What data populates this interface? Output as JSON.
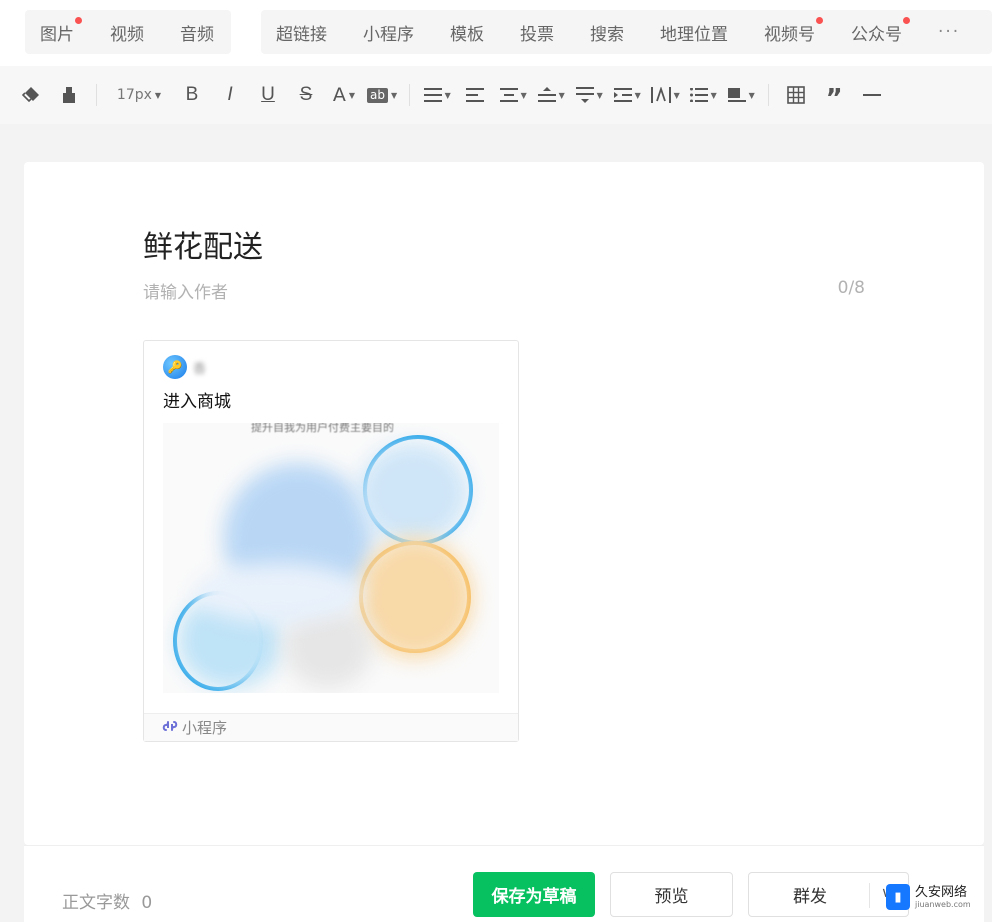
{
  "insert_tabs": {
    "group1": [
      {
        "label": "图片",
        "dot": true
      },
      {
        "label": "视频",
        "dot": false
      },
      {
        "label": "音频",
        "dot": false
      }
    ],
    "group2": [
      {
        "label": "超链接",
        "dot": false
      },
      {
        "label": "小程序",
        "dot": false
      },
      {
        "label": "模板",
        "dot": false
      },
      {
        "label": "投票",
        "dot": false
      },
      {
        "label": "搜索",
        "dot": false
      },
      {
        "label": "地理位置",
        "dot": false
      },
      {
        "label": "视频号",
        "dot": true
      },
      {
        "label": "公众号",
        "dot": true
      }
    ],
    "more": "···"
  },
  "toolbar": {
    "font_size": "17px",
    "items": [
      "eraser-icon",
      "format-painter-icon",
      "font-size",
      "bold-icon",
      "italic-icon",
      "underline-icon",
      "strikethrough-icon",
      "font-color-icon",
      "background-color-icon",
      "align-icon",
      "indent-icon",
      "line-spacing-icon",
      "paragraph-spacing-icon",
      "text-spacing-icon",
      "letter-spacing-icon",
      "list-icon",
      "border-icon",
      "table-icon",
      "quote-icon",
      "divider-icon"
    ]
  },
  "article": {
    "title": "鲜花配送",
    "author_placeholder": "请输入作者",
    "author_counter": "0/8"
  },
  "mini_program_card": {
    "name": "香            ",
    "description": "进入商城",
    "cover_caption": "提升自我为用户付费主要目的",
    "footer_label": "小程序"
  },
  "bottom": {
    "word_count_label": "正文字数",
    "word_count_value": "0",
    "save_draft": "保存为草稿",
    "preview": "预览",
    "mass_send": "群发"
  },
  "watermark": {
    "cn": "久安网络",
    "en": "jiuanweb.com"
  },
  "colors": {
    "primary_green": "#07c160",
    "notification_dot": "#fa5151",
    "mini_program_icon": "#6b6fd6"
  }
}
